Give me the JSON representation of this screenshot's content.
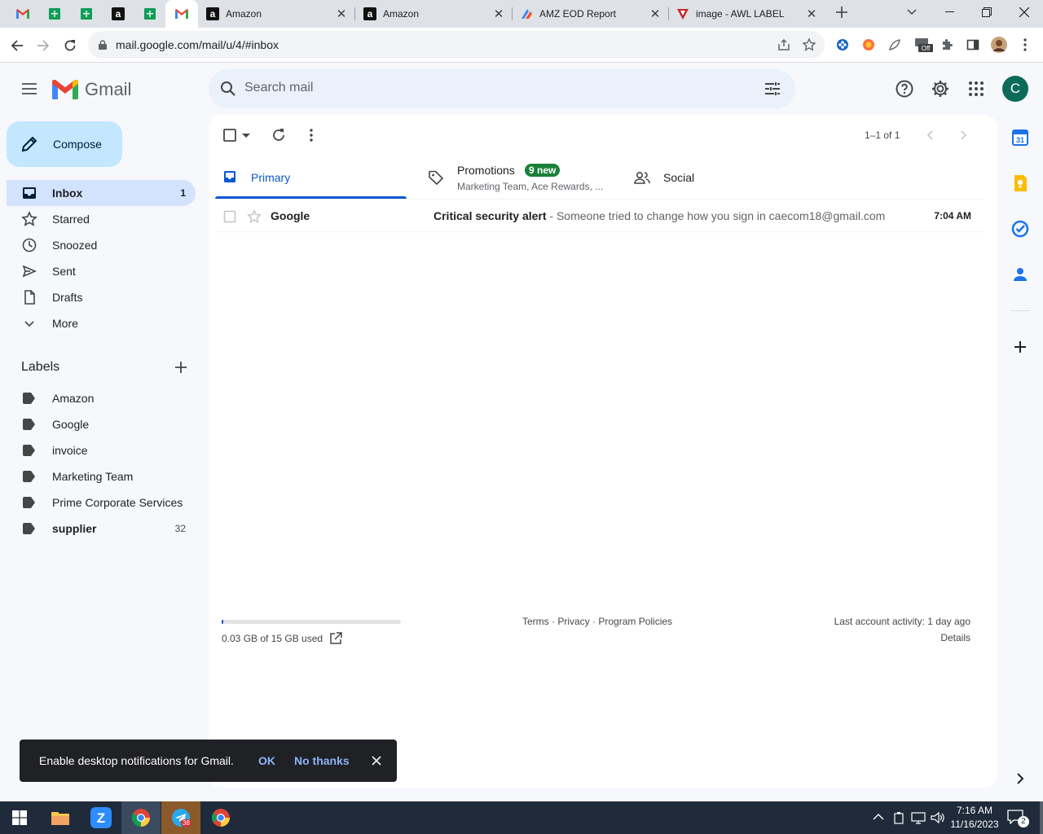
{
  "browser": {
    "tabs": [
      {
        "label": "Amazon",
        "icon": "amazon-icon"
      },
      {
        "label": "Amazon",
        "icon": "amazon-icon"
      },
      {
        "label": "AMZ EOD Report",
        "icon": "report-icon"
      },
      {
        "label": "image - AWL LABEL",
        "icon": "awl-icon"
      }
    ],
    "url": "mail.google.com/mail/u/4/#inbox"
  },
  "gmail": {
    "brand": "Gmail",
    "search_placeholder": "Search mail",
    "avatar_letter": "C"
  },
  "sidebar": {
    "compose": "Compose",
    "items": [
      {
        "label": "Inbox",
        "count": "1"
      },
      {
        "label": "Starred",
        "count": ""
      },
      {
        "label": "Snoozed",
        "count": ""
      },
      {
        "label": "Sent",
        "count": ""
      },
      {
        "label": "Drafts",
        "count": ""
      },
      {
        "label": "More",
        "count": ""
      }
    ],
    "labels_heading": "Labels",
    "labels": [
      {
        "label": "Amazon",
        "count": ""
      },
      {
        "label": "Google",
        "count": ""
      },
      {
        "label": "invoice",
        "count": ""
      },
      {
        "label": "Marketing Team",
        "count": ""
      },
      {
        "label": "Prime Corporate Services",
        "count": ""
      },
      {
        "label": "supplier",
        "count": "32"
      }
    ]
  },
  "toolbar": {
    "pager": "1–1 of 1"
  },
  "categories": {
    "primary": "Primary",
    "promotions": "Promotions",
    "promotions_badge": "9 new",
    "promotions_sub": "Marketing Team, Ace Rewards, ...",
    "social": "Social"
  },
  "emails": [
    {
      "sender": "Google",
      "subject": "Critical security alert",
      "snippet": " - Someone tried to change how you sign in caecom18@gmail.com",
      "time": "7:04 AM"
    }
  ],
  "footer": {
    "storage": "0.03 GB of 15 GB used",
    "storage_fraction": 0.002,
    "terms": "Terms",
    "privacy": "Privacy",
    "policies": "Program Policies",
    "activity": "Last account activity: 1 day ago",
    "details": "Details"
  },
  "snackbar": {
    "text": "Enable desktop notifications for Gmail.",
    "ok": "OK",
    "no_thanks": "No thanks"
  },
  "taskbar": {
    "telegram_badge": "38",
    "time": "7:16 AM",
    "date": "11/16/2023",
    "notif_count": "2"
  }
}
